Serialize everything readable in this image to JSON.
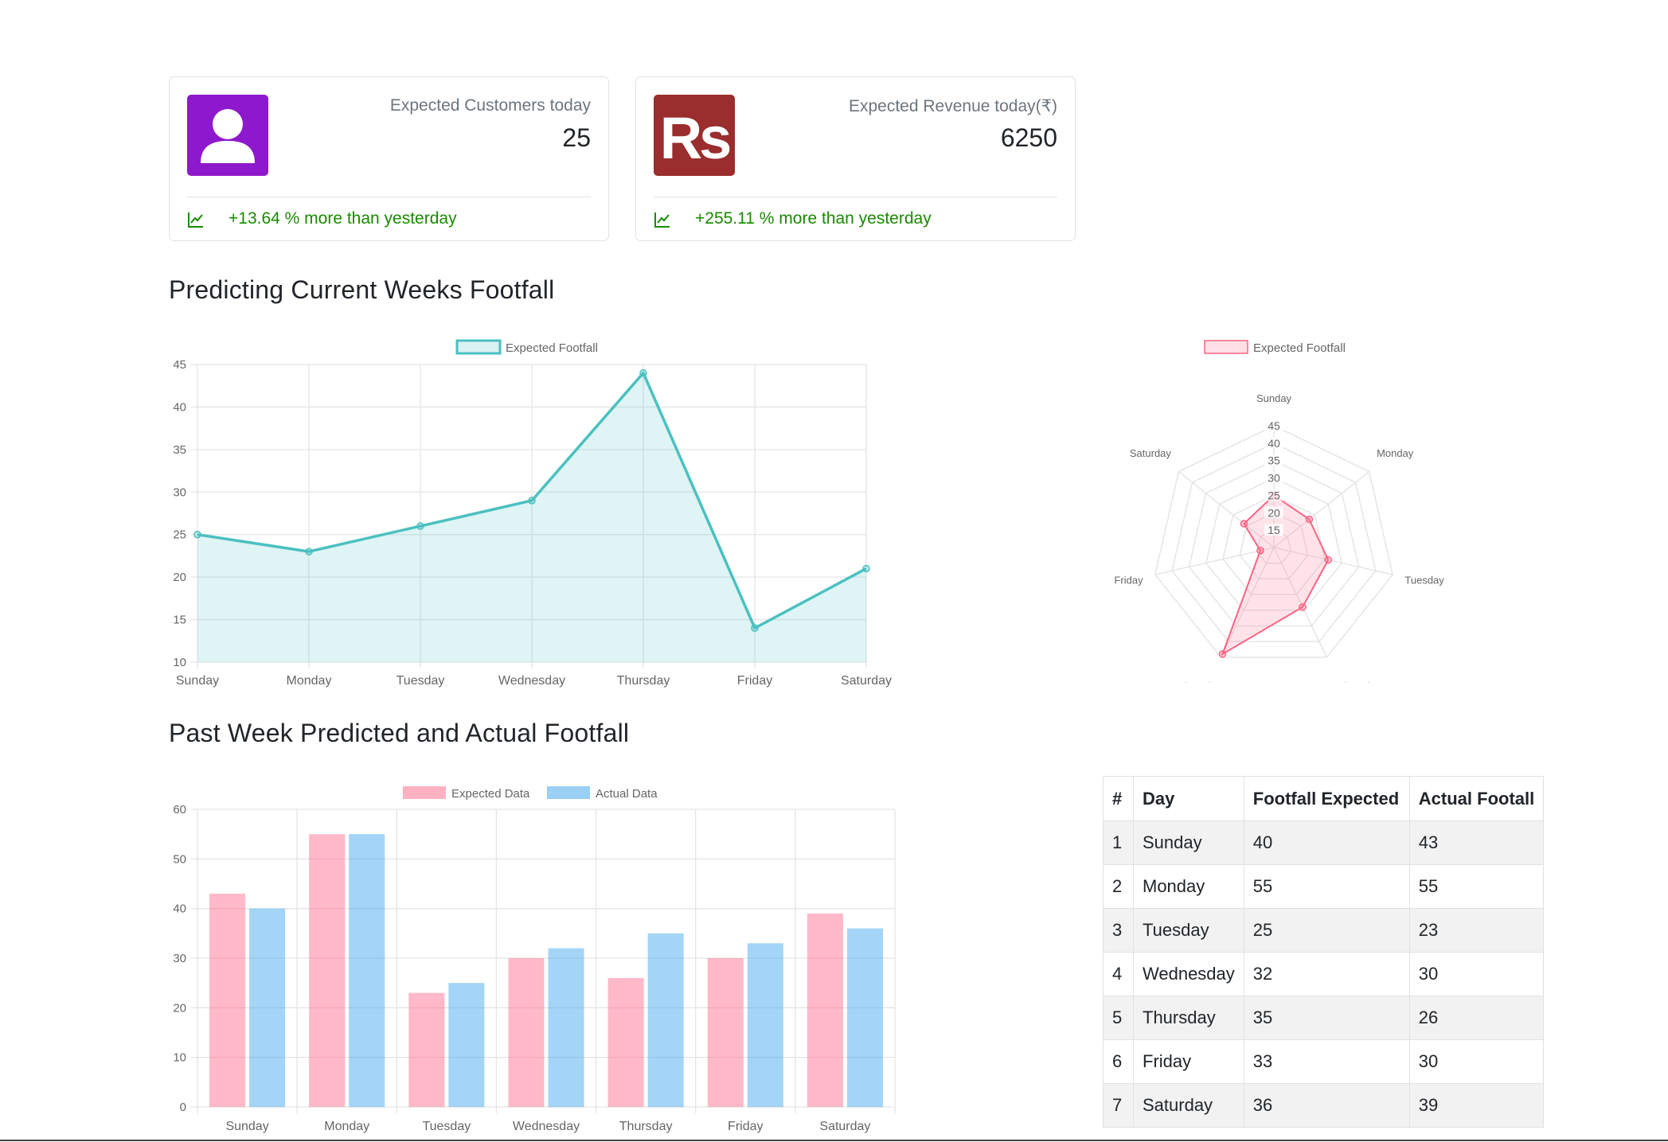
{
  "cards": [
    {
      "label": "Expected Customers today",
      "value": "25",
      "trend": "+13.64 % more than yesterday",
      "icon": "user-icon",
      "icon_color": "#8e19cc"
    },
    {
      "label": "Expected Revenue today(₹)",
      "value": "6250",
      "trend": "+255.11 % more than yesterday",
      "icon": "rupee-logo",
      "logo_text": "Rs",
      "icon_color": "#9a2d2d"
    }
  ],
  "trend_color": "#198a00",
  "sections": {
    "current_title": "Predicting Current Weeks Footfall",
    "past_title": "Past Week Predicted and Actual Footfall"
  },
  "chart_data": [
    {
      "type": "line",
      "fill": "area",
      "categories": [
        "Sunday",
        "Monday",
        "Tuesday",
        "Wednesday",
        "Thursday",
        "Friday",
        "Saturday"
      ],
      "series": [
        {
          "name": "Expected Footfall",
          "values": [
            25,
            23,
            26,
            29,
            44,
            14,
            21
          ],
          "color": "#4bc0c0"
        }
      ],
      "ylim": [
        10,
        45
      ],
      "yticks": [
        10,
        15,
        20,
        25,
        30,
        35,
        40,
        45
      ],
      "grid": true,
      "legend": "top-center"
    },
    {
      "type": "radar",
      "categories": [
        "Sunday",
        "Monday",
        "Tuesday",
        "Wednesday",
        "Thursday",
        "Friday",
        "Saturday"
      ],
      "series": [
        {
          "name": "Expected Footfall",
          "values": [
            25,
            23,
            26,
            29,
            44,
            14,
            21
          ],
          "color": "#ff6384"
        }
      ],
      "rlim": [
        10,
        45
      ],
      "rticks": [
        15,
        20,
        25,
        30,
        35,
        40,
        45
      ],
      "legend": "top-center"
    },
    {
      "type": "bar",
      "categories": [
        "Sunday",
        "Monday",
        "Tuesday",
        "Wednesday",
        "Thursday",
        "Friday",
        "Saturday"
      ],
      "series": [
        {
          "name": "Expected Data",
          "values": [
            43,
            55,
            23,
            30,
            26,
            30,
            39
          ],
          "color": "#ff6384"
        },
        {
          "name": "Actual Data",
          "values": [
            40,
            55,
            25,
            32,
            35,
            33,
            36
          ],
          "color": "#36a2eb"
        }
      ],
      "ylim": [
        0,
        60
      ],
      "yticks": [
        0,
        10,
        20,
        30,
        40,
        50,
        60
      ],
      "grid": true,
      "legend": "top-center"
    }
  ],
  "table": {
    "headers": [
      "#",
      "Day",
      "Footfall Expected",
      "Actual Footall"
    ],
    "rows": [
      [
        "1",
        "Sunday",
        "40",
        "43"
      ],
      [
        "2",
        "Monday",
        "55",
        "55"
      ],
      [
        "3",
        "Tuesday",
        "25",
        "23"
      ],
      [
        "4",
        "Wednesday",
        "32",
        "30"
      ],
      [
        "5",
        "Thursday",
        "35",
        "26"
      ],
      [
        "6",
        "Friday",
        "33",
        "30"
      ],
      [
        "7",
        "Saturday",
        "36",
        "39"
      ]
    ]
  }
}
